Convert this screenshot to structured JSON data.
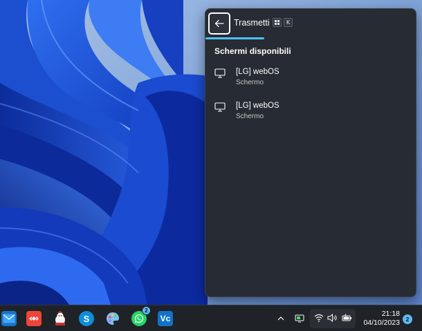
{
  "flyout": {
    "title": "Trasmetti",
    "shortcut_keys": [
      "K"
    ],
    "progress_fraction": 0.28,
    "section_title": "Schermi disponibili",
    "devices": [
      {
        "name": "[LG] webOS",
        "type": "Schermo",
        "icon": "monitor-icon"
      },
      {
        "name": "[LG] webOS",
        "type": "Schermo",
        "icon": "monitor-icon"
      }
    ]
  },
  "taskbar": {
    "apps": [
      {
        "name": "mail",
        "icon": "mail-icon"
      },
      {
        "name": "anydesk",
        "icon": "anydesk-icon"
      },
      {
        "name": "mascot-app",
        "icon": "mascot-icon"
      },
      {
        "name": "skype",
        "icon": "skype-icon",
        "letter": "S"
      },
      {
        "name": "paint",
        "icon": "paint-palette-icon"
      },
      {
        "name": "whatsapp",
        "icon": "whatsapp-icon",
        "badge": "2"
      },
      {
        "name": "virtual-box",
        "icon": "vb-icon",
        "letter": "V"
      }
    ],
    "tray": {
      "time": "21:18",
      "date": "04/10/2023",
      "notification_count": "2"
    }
  },
  "colors": {
    "flyout_bg": "#272b33",
    "accent": "#4cc2ff",
    "taskbar_bg": "#1f2226",
    "wallpaper_base": "#1e3f8c"
  }
}
